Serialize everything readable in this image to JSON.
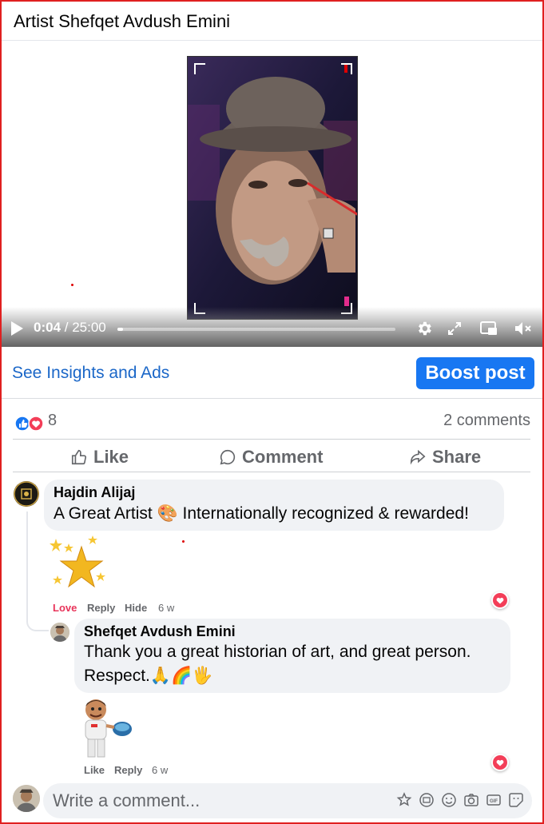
{
  "post": {
    "title": "Artist Shefqet Avdush Emini"
  },
  "video": {
    "current_time": "0:04",
    "separator": " / ",
    "duration": "25:00",
    "progress_fraction": 0.003
  },
  "insights": {
    "link_label": "See Insights and Ads",
    "boost_label": "Boost post"
  },
  "stats": {
    "reaction_count": "8",
    "comments_label": "2 comments"
  },
  "actions": {
    "like": "Like",
    "comment": "Comment",
    "share": "Share"
  },
  "comments": [
    {
      "author": "Hajdin Alijaj",
      "text": "A Great Artist 🎨 Internationally recognized & rewarded!",
      "sticker": "golden-stars",
      "actions": [
        "Love",
        "Reply",
        "Hide"
      ],
      "time": "6 w",
      "reaction": "love"
    },
    {
      "author": "Shefqet Avdush Emini",
      "text_line1": "Thank you a great historian of art, and great person.",
      "text_line2": "Respect.🙏🌈🖐",
      "sticker": "chef-character",
      "actions": [
        "Like",
        "Reply"
      ],
      "time": "6 w",
      "reaction": "love"
    }
  ],
  "composer": {
    "placeholder": "Write a comment...",
    "tools": [
      "avatar-sticker-icon",
      "comment-sticker-icon",
      "emoji-icon",
      "camera-icon",
      "gif-icon",
      "sticker-icon"
    ]
  },
  "colors": {
    "accent": "#1877f2",
    "link": "#1b67c8",
    "love": "#e8345a",
    "border": "#e02020"
  }
}
